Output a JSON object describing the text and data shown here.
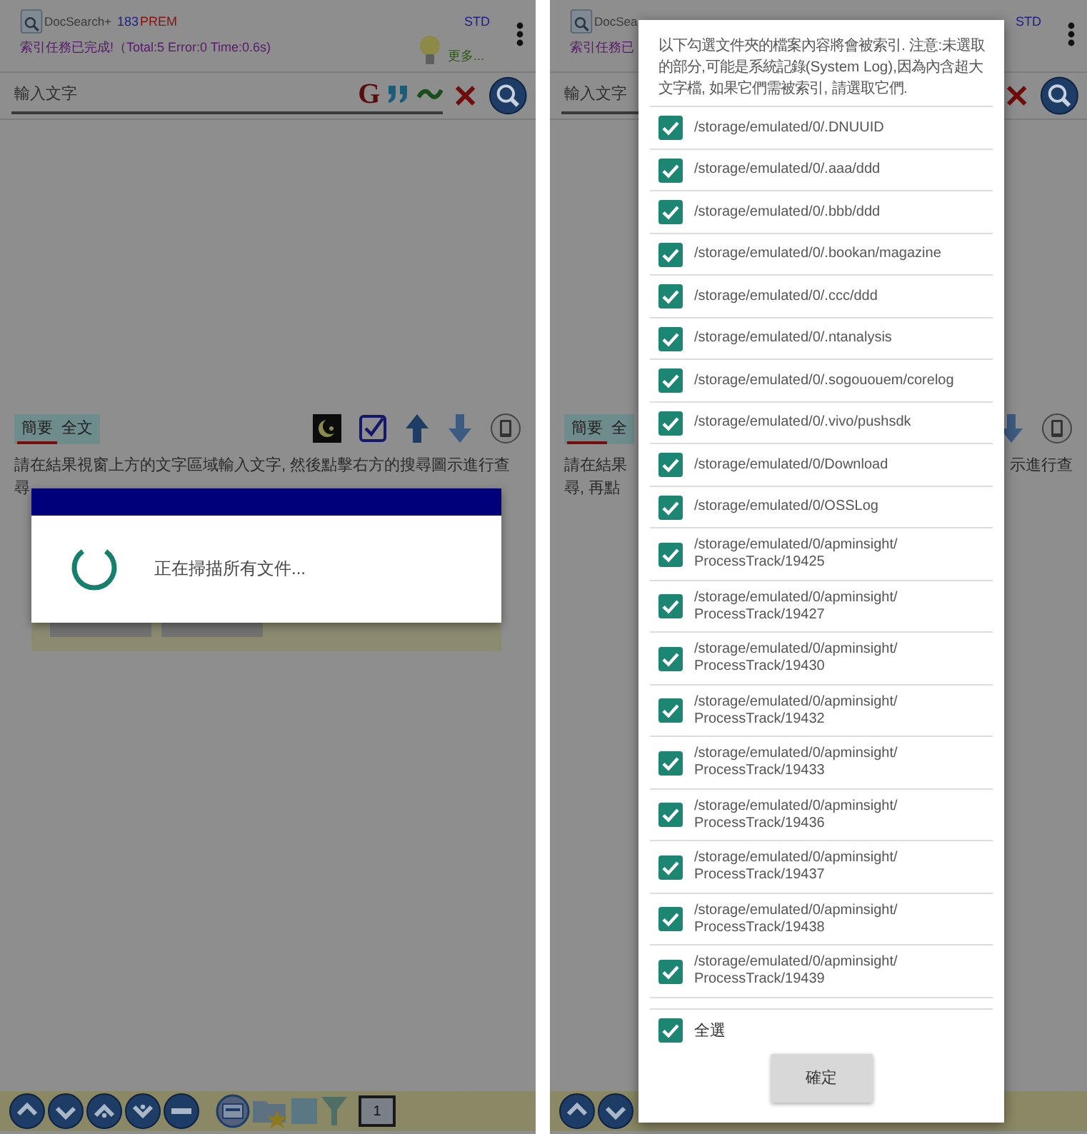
{
  "screens": [
    {
      "background": {
        "app_name": "DocSearch+",
        "version": "183",
        "edition": "PREM",
        "license": "STD",
        "status": "索引任務已完成!（Total:5 Error:0 Time:0.6s)",
        "more": "更多...",
        "search": {
          "placeholder": "輸入文字",
          "google_label": "G"
        },
        "tabs": [
          {
            "label": "簡要",
            "selected": true
          },
          {
            "label": "全文",
            "selected": false
          }
        ],
        "help_lines": [
          {
            "left": "請在結果視窗上方的文字區域輸入文字, 然後點擊右方的搜尋圖示進行查"
          },
          {
            "left": "尋"
          }
        ],
        "view_icons": {
          "kind": "full"
        },
        "toolbar": {
          "kind": "full",
          "page": "1"
        }
      },
      "dialog": {
        "kind": "progress",
        "message": "正在掃描所有文件..."
      }
    },
    {
      "background": {
        "app_name": "DocSea",
        "license": "STD",
        "status": "索引任務已",
        "search": {
          "placeholder": "輸入文字"
        },
        "tabs": [
          {
            "label": "簡要",
            "selected": true
          },
          {
            "label": "全",
            "selected": false
          }
        ],
        "help_lines": [
          {
            "left": "請在結果",
            "right": "示進行查"
          },
          {
            "left": "尋, 再點"
          }
        ],
        "view_icons": {
          "kind": "partial"
        },
        "toolbar": {
          "kind": "partial"
        }
      },
      "dialog": {
        "kind": "folder_select",
        "note": "以下勾選文件夾的檔案內容將會被索引. 注意:未選取的部分,可能是系統記錄(System Log),因為內含超大文字檔, 如果它們需被索引, 請選取它們.",
        "folders": [
          {
            "path": "/storage/emulated/0/.DNUUID",
            "checked": true
          },
          {
            "path": "/storage/emulated/0/.aaa/ddd",
            "checked": true
          },
          {
            "path": "/storage/emulated/0/.bbb/ddd",
            "checked": true
          },
          {
            "path": "/storage/emulated/0/.bookan/magazine",
            "checked": true
          },
          {
            "path": "/storage/emulated/0/.ccc/ddd",
            "checked": true
          },
          {
            "path": "/storage/emulated/0/.ntanalysis",
            "checked": true
          },
          {
            "path": "/storage/emulated/0/.sogououem/corelog",
            "checked": true
          },
          {
            "path": "/storage/emulated/0/.vivo/pushsdk",
            "checked": true
          },
          {
            "path": "/storage/emulated/0/Download",
            "checked": true
          },
          {
            "path": "/storage/emulated/0/OSSLog",
            "checked": true
          },
          {
            "path": "/storage/emulated/0/apminsight/\nProcessTrack/19425",
            "checked": true
          },
          {
            "path": "/storage/emulated/0/apminsight/\nProcessTrack/19427",
            "checked": true
          },
          {
            "path": "/storage/emulated/0/apminsight/\nProcessTrack/19430",
            "checked": true
          },
          {
            "path": "/storage/emulated/0/apminsight/\nProcessTrack/19432",
            "checked": true
          },
          {
            "path": "/storage/emulated/0/apminsight/\nProcessTrack/19433",
            "checked": true
          },
          {
            "path": "/storage/emulated/0/apminsight/\nProcessTrack/19436",
            "checked": true
          },
          {
            "path": "/storage/emulated/0/apminsight/\nProcessTrack/19437",
            "checked": true
          },
          {
            "path": "/storage/emulated/0/apminsight/\nProcessTrack/19438",
            "checked": true
          },
          {
            "path": "/storage/emulated/0/apminsight/\nProcessTrack/19439",
            "checked": true
          }
        ],
        "select_all": {
          "label": "全選",
          "checked": true
        },
        "confirm": "確定"
      }
    }
  ]
}
